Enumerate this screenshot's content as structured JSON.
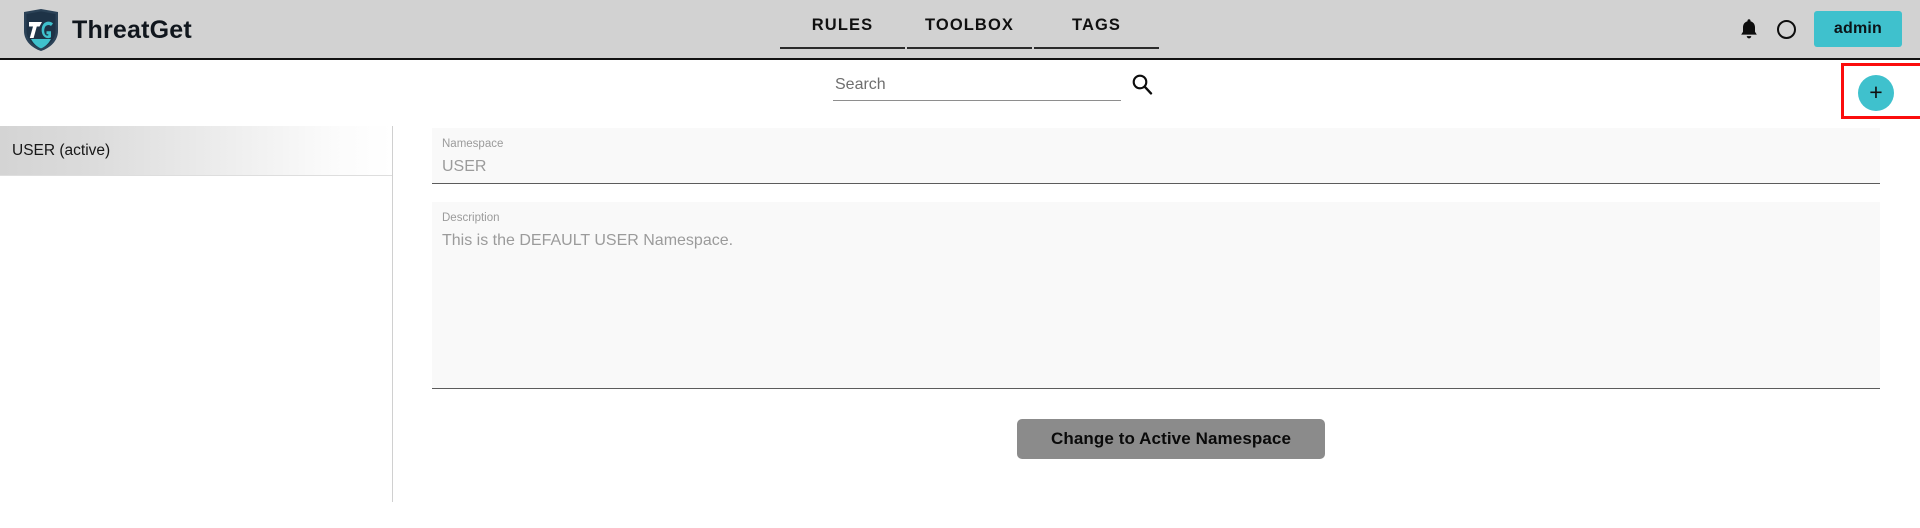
{
  "app": {
    "name": "ThreatGet",
    "logo_icon": "shield-logo-icon",
    "accent_color": "#3fc1cd",
    "highlight_color": "#fb0d0d"
  },
  "topbar": {
    "tabs": [
      {
        "label": "RULES"
      },
      {
        "label": "TOOLBOX"
      },
      {
        "label": "TAGS"
      }
    ],
    "notification_icon": "bell-icon",
    "status_icon": "circle-icon",
    "user_button": "admin"
  },
  "search": {
    "value": "",
    "placeholder": "Search",
    "icon": "search-icon"
  },
  "add": {
    "label": "+",
    "icon": "plus-icon"
  },
  "sidebar": {
    "items": [
      {
        "label": "USER (active)"
      }
    ]
  },
  "form": {
    "namespace": {
      "label": "Namespace",
      "value": "USER"
    },
    "description": {
      "label": "Description",
      "value": "This is the DEFAULT USER Namespace."
    },
    "change_button": "Change to Active Namespace"
  }
}
